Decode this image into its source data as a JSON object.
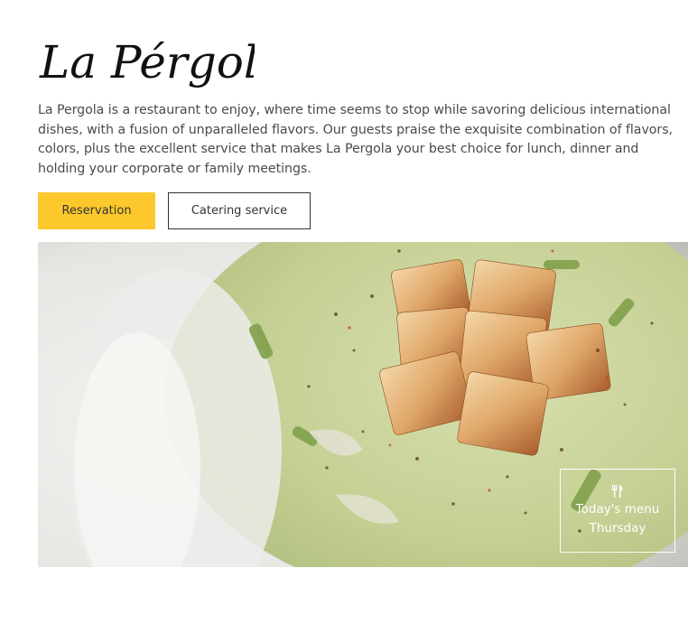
{
  "brand": {
    "logo_text": "La Pérgola"
  },
  "intro": {
    "text": "La Pergola is a restaurant to enjoy, where time seems to stop while savoring delicious international dishes, with a fusion of unparalleled flavors. Our guests praise the exquisite combination of flavors, colors, plus the excellent service that makes La Pergola your best choice for lunch, dinner and holding your corporate or family meetings."
  },
  "buttons": {
    "reservation": "Reservation",
    "catering": "Catering service"
  },
  "todays_menu": {
    "icon": "fork-knife-icon",
    "title": "Today's menu",
    "day": "Thursday"
  },
  "colors": {
    "accent": "#fcc82c",
    "text": "#4a4a4a",
    "logo": "#111111"
  }
}
